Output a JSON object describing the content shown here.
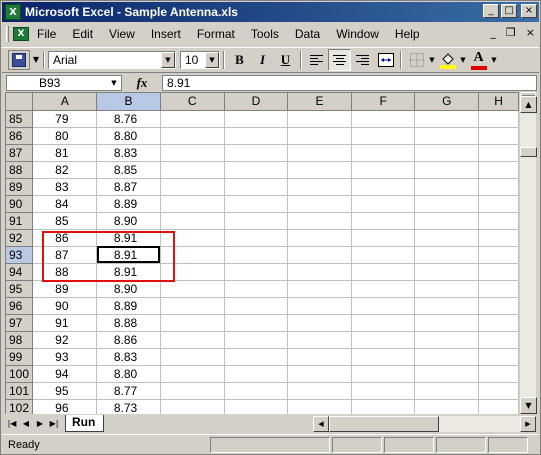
{
  "window": {
    "app_icon": "X",
    "title": "Microsoft Excel - Sample Antenna.xls",
    "buttons": {
      "minimize": "_",
      "maximize": "□",
      "close": "×"
    }
  },
  "menu": {
    "items": [
      "File",
      "Edit",
      "View",
      "Insert",
      "Format",
      "Tools",
      "Data",
      "Window",
      "Help"
    ],
    "right": {
      "minimize": "_",
      "restore": "❐",
      "close": "×"
    }
  },
  "toolbar": {
    "font_name": "Arial",
    "font_size": "10",
    "bold": "B",
    "italic": "I",
    "underline": "U",
    "font_color_letter": "A",
    "fill_color": "#ffff00",
    "font_color": "#e00000"
  },
  "formula_bar": {
    "name_box": "B93",
    "fx": "fx",
    "formula": "8.91"
  },
  "grid": {
    "columns": [
      "A",
      "B",
      "C",
      "D",
      "E",
      "F",
      "G",
      "H"
    ],
    "selected_column": "B",
    "active_cell": "B93",
    "rows": [
      {
        "row": "85",
        "a": "79",
        "b": "8.76"
      },
      {
        "row": "86",
        "a": "80",
        "b": "8.80"
      },
      {
        "row": "87",
        "a": "81",
        "b": "8.83"
      },
      {
        "row": "88",
        "a": "82",
        "b": "8.85"
      },
      {
        "row": "89",
        "a": "83",
        "b": "8.87"
      },
      {
        "row": "90",
        "a": "84",
        "b": "8.89"
      },
      {
        "row": "91",
        "a": "85",
        "b": "8.90"
      },
      {
        "row": "92",
        "a": "86",
        "b": "8.91"
      },
      {
        "row": "93",
        "a": "87",
        "b": "8.91"
      },
      {
        "row": "94",
        "a": "88",
        "b": "8.91"
      },
      {
        "row": "95",
        "a": "89",
        "b": "8.90"
      },
      {
        "row": "96",
        "a": "90",
        "b": "8.89"
      },
      {
        "row": "97",
        "a": "91",
        "b": "8.88"
      },
      {
        "row": "98",
        "a": "92",
        "b": "8.86"
      },
      {
        "row": "99",
        "a": "93",
        "b": "8.83"
      },
      {
        "row": "100",
        "a": "94",
        "b": "8.80"
      },
      {
        "row": "101",
        "a": "95",
        "b": "8.77"
      },
      {
        "row": "102",
        "a": "96",
        "b": "8.73"
      }
    ]
  },
  "annotation": {
    "highlight_color": "#e01010"
  },
  "sheets": {
    "active": "Run"
  },
  "status": {
    "text": "Ready"
  }
}
